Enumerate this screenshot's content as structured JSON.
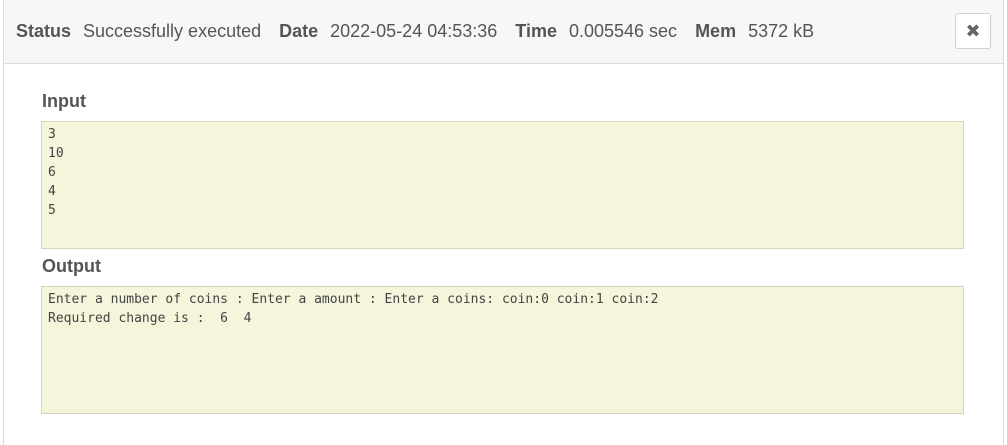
{
  "header": {
    "status_label": "Status",
    "status_value": "Successfully executed",
    "date_label": "Date",
    "date_value": "2022-05-24 04:53:36",
    "time_label": "Time",
    "time_value": "0.005546 sec",
    "mem_label": "Mem",
    "mem_value": "5372 kB",
    "close_glyph": "✖"
  },
  "input": {
    "title": "Input",
    "content": "3\n10\n6\n4\n5"
  },
  "output": {
    "title": "Output",
    "content": "Enter a number of coins : Enter a amount : Enter a coins: coin:0 coin:1 coin:2\nRequired change is :  6  4"
  },
  "colors": {
    "header_bg": "#f6f7f8",
    "io_box_bg": "#f5f5dc",
    "text": "#555555"
  }
}
